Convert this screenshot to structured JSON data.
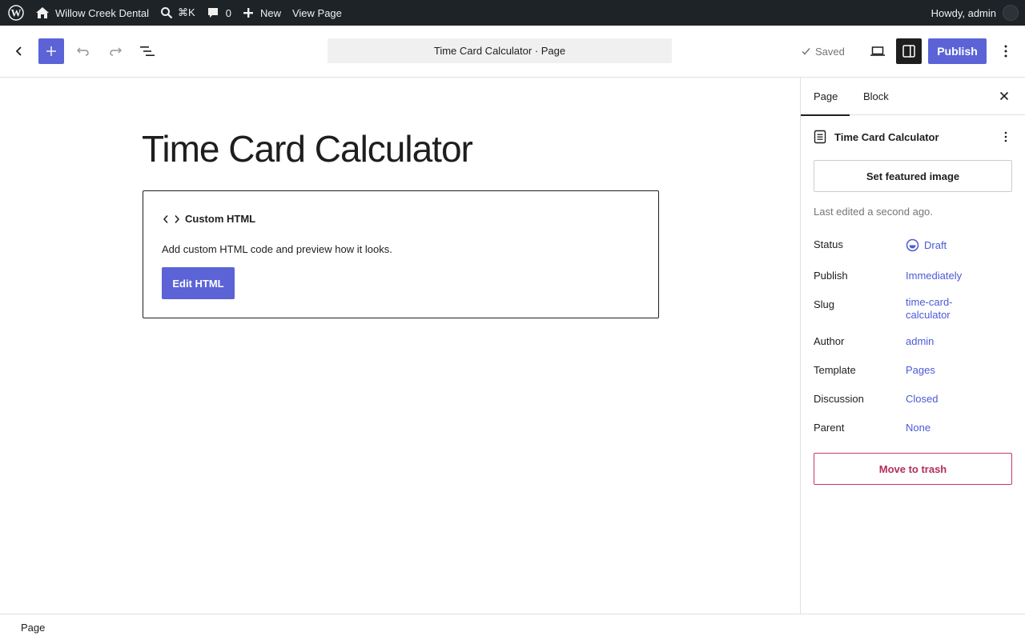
{
  "adminbar": {
    "site_name": "Willow Creek Dental",
    "search_shortcut": "⌘K",
    "comments_count": "0",
    "new_label": "New",
    "view_page_label": "View Page",
    "howdy": "Howdy, admin"
  },
  "header": {
    "doc_title": "Time Card Calculator · Page",
    "saved_label": "Saved",
    "publish_label": "Publish"
  },
  "canvas": {
    "page_title": "Time Card Calculator",
    "block": {
      "label": "Custom HTML",
      "description": "Add custom HTML code and preview how it looks.",
      "edit_button": "Edit HTML"
    }
  },
  "sidebar": {
    "tabs": [
      {
        "label": "Page",
        "active": true
      },
      {
        "label": "Block",
        "active": false
      }
    ],
    "doc_name": "Time Card Calculator",
    "featured_image_button": "Set featured image",
    "last_edited": "Last edited a second ago.",
    "meta": [
      {
        "label": "Status",
        "value": "Draft"
      },
      {
        "label": "Publish",
        "value": "Immediately"
      },
      {
        "label": "Slug",
        "value": "time-card-calculator"
      },
      {
        "label": "Author",
        "value": "admin"
      },
      {
        "label": "Template",
        "value": "Pages"
      },
      {
        "label": "Discussion",
        "value": "Closed"
      },
      {
        "label": "Parent",
        "value": "None"
      }
    ],
    "trash_button": "Move to trash"
  },
  "footer": {
    "breadcrumb": "Page"
  },
  "colors": {
    "accent": "#5b63d7",
    "link": "#4a5bd6",
    "danger": "#b32d5e",
    "adminbar_bg": "#1d2327"
  }
}
